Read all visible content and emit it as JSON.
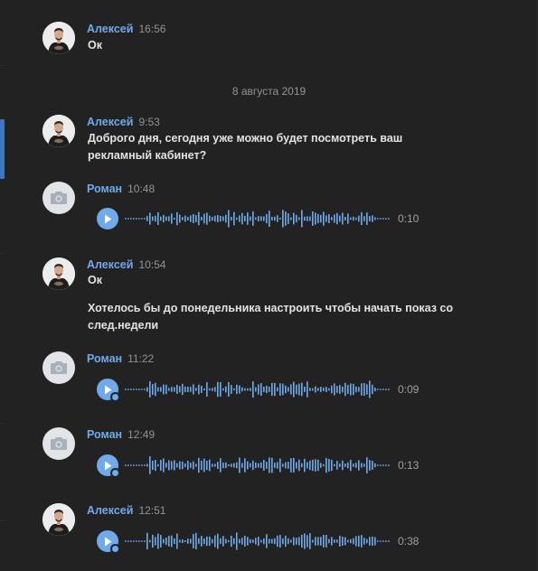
{
  "date_separator": "8 августа 2019",
  "accent_color": "#71aaeb",
  "messages": [
    {
      "author": "Алексей",
      "time": "16:56",
      "avatar": "photo-avatar",
      "lines": [
        "Ок"
      ]
    },
    {
      "author": "Алексей",
      "time": "9:53",
      "avatar": "photo-avatar",
      "lines": [
        "Доброго дня, сегодня уже можно будет посмотреть ваш",
        "рекламный кабинет?"
      ]
    },
    {
      "author": "Роман",
      "time": "10:48",
      "avatar": "camera-icon",
      "voice": {
        "duration": "0:10",
        "unread": false
      }
    },
    {
      "author": "Алексей",
      "time": "10:54",
      "avatar": "photo-avatar",
      "lines": [
        "Ок"
      ],
      "extra_lines": [
        "Хотелось бы до понедельника настроить чтобы начать показ со",
        "след.недели"
      ]
    },
    {
      "author": "Роман",
      "time": "11:22",
      "avatar": "camera-icon",
      "voice": {
        "duration": "0:09",
        "unread": true
      }
    },
    {
      "author": "Роман",
      "time": "12:49",
      "avatar": "camera-icon",
      "voice": {
        "duration": "0:13",
        "unread": true
      }
    },
    {
      "author": "Алексей",
      "time": "12:51",
      "avatar": "photo-avatar",
      "voice": {
        "duration": "0:38",
        "unread": true
      }
    }
  ]
}
